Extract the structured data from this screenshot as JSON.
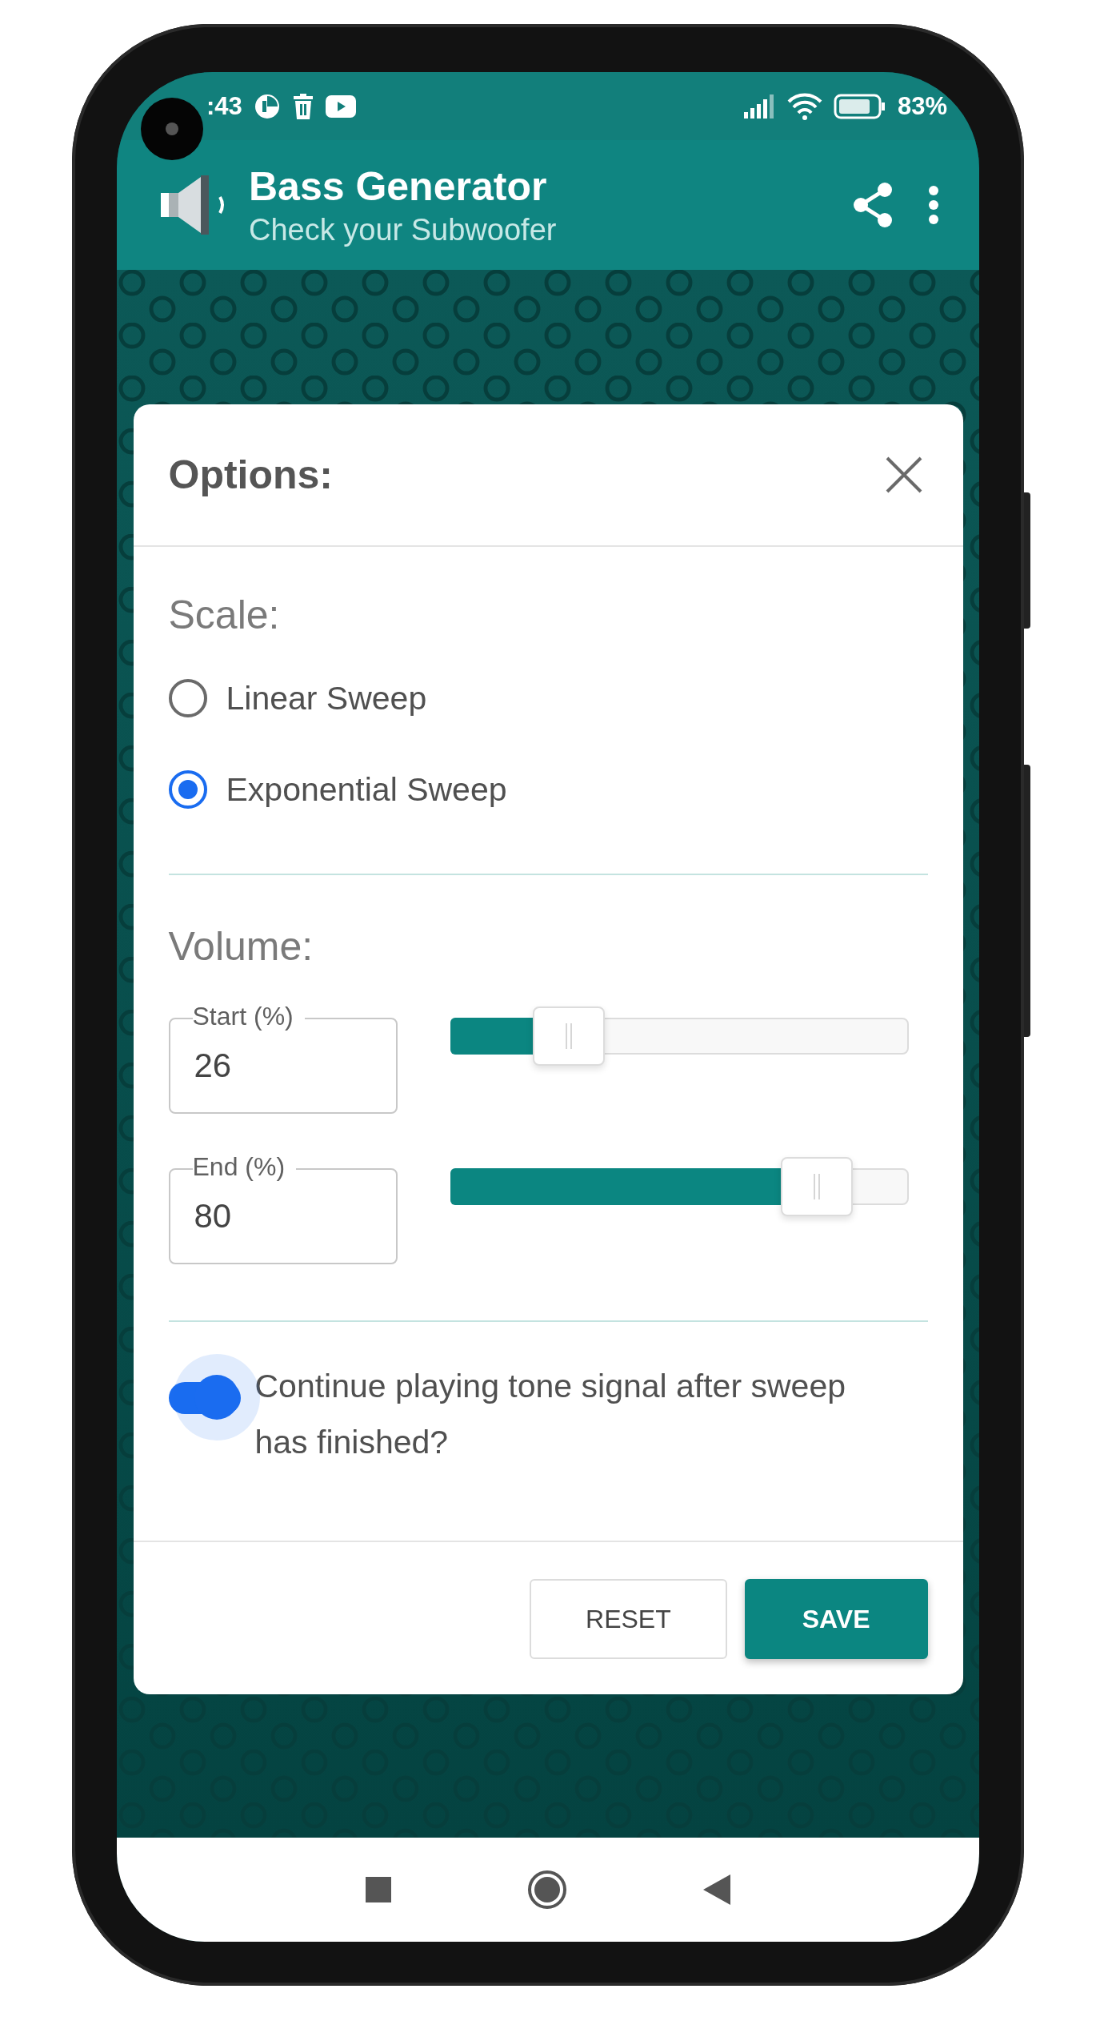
{
  "status_bar": {
    "time": ":43",
    "battery": "83%"
  },
  "app_bar": {
    "title": "Bass Generator",
    "subtitle": "Check your Subwoofer"
  },
  "dialog": {
    "title": "Options:",
    "scale": {
      "label": "Scale:",
      "options": [
        {
          "label": "Linear Sweep",
          "selected": false
        },
        {
          "label": "Exponential Sweep",
          "selected": true
        }
      ]
    },
    "volume": {
      "label": "Volume:",
      "fields": [
        {
          "label": "Start (%)",
          "value": "26",
          "level": 0.26
        },
        {
          "label": "End (%)",
          "value": "80",
          "level": 0.8
        }
      ]
    },
    "continue_toggle": {
      "label": "Continue playing tone signal after sweep has finished?",
      "on": true
    },
    "buttons": [
      {
        "label": "RESET",
        "kind": "outlined"
      },
      {
        "label": "SAVE",
        "kind": "filled"
      }
    ]
  }
}
